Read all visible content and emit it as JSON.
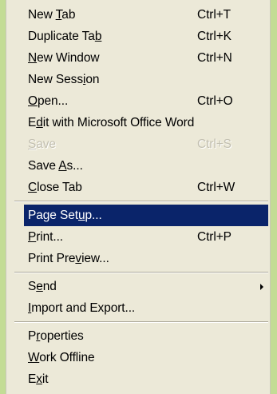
{
  "menu": {
    "items": [
      {
        "label": "New Tab",
        "mnemonic": "T",
        "shortcut": "Ctrl+T"
      },
      {
        "label": "Duplicate Tab",
        "mnemonic": "b",
        "shortcut": "Ctrl+K"
      },
      {
        "label": "New Window",
        "mnemonic": "N",
        "shortcut": "Ctrl+N"
      },
      {
        "label": "New Session",
        "mnemonic": "i",
        "shortcut": ""
      },
      {
        "label": "Open...",
        "mnemonic": "O",
        "shortcut": "Ctrl+O"
      },
      {
        "label": "Edit with Microsoft Office Word",
        "mnemonic": "d",
        "shortcut": ""
      },
      {
        "label": "Save",
        "mnemonic": "S",
        "shortcut": "Ctrl+S",
        "disabled": true
      },
      {
        "label": "Save As...",
        "mnemonic": "A",
        "shortcut": ""
      },
      {
        "label": "Close Tab",
        "mnemonic": "C",
        "shortcut": "Ctrl+W"
      },
      {
        "label": "Page Setup...",
        "mnemonic": "u",
        "shortcut": "",
        "selected": true
      },
      {
        "label": "Print...",
        "mnemonic": "P",
        "shortcut": "Ctrl+P"
      },
      {
        "label": "Print Preview...",
        "mnemonic": "v",
        "shortcut": ""
      },
      {
        "label": "Send",
        "mnemonic": "e",
        "shortcut": "",
        "submenu": true
      },
      {
        "label": "Import and Export...",
        "mnemonic": "I",
        "shortcut": ""
      },
      {
        "label": "Properties",
        "mnemonic": "r",
        "shortcut": ""
      },
      {
        "label": "Work Offline",
        "mnemonic": "W",
        "shortcut": ""
      },
      {
        "label": "Exit",
        "mnemonic": "x",
        "shortcut": ""
      }
    ]
  },
  "colors": {
    "background": "#c3dc95",
    "menu": "#ece9d8",
    "highlight": "#0a246a",
    "disabled_text": "#c2bfb0"
  },
  "icons": {
    "submenu_arrow": "chevron-right-icon"
  }
}
